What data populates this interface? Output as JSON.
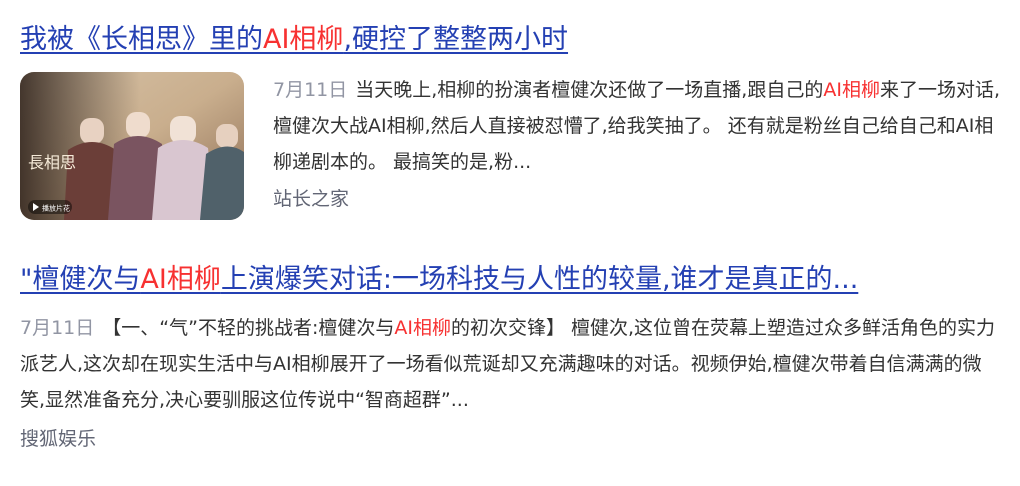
{
  "results": [
    {
      "title_parts": {
        "pre": "我被《长相思》里的",
        "hl": "AI相柳",
        "post": ",硬控了整整两小时"
      },
      "thumbnail": {
        "logo_text": "長相思",
        "button_text": "播放片花"
      },
      "date": "7月11日",
      "abstract_parts": {
        "pre": "当天晚上,相柳的扮演者檀健次还做了一场直播,跟自己的",
        "hl": "AI相柳",
        "post": "来了一场对话,檀健次大战AI相柳,然后人直接被怼懵了,给我笑抽了。 还有就是粉丝自己给自己和AI相柳递剧本的。 最搞笑的是,粉..."
      },
      "source": "站长之家"
    },
    {
      "title_parts": {
        "pre": "\"檀健次与",
        "hl": "AI相柳",
        "post": "上演爆笑对话:一场科技与人性的较量,谁才是真正的..."
      },
      "date": "7月11日",
      "abstract_parts": {
        "pre": "【一、“气”不轻的挑战者:檀健次与",
        "hl": "AI相柳",
        "post": "的初次交锋】 檀健次,这位曾在荧幕上塑造过众多鲜活角色的实力派艺人,这次却在现实生活中与AI相柳展开了一场看似荒诞却又充满趣味的对话。视频伊始,檀健次带着自信满满的微笑,显然准备充分,决心要驯服这位传说中“智商超群”..."
      },
      "source": "搜狐娱乐"
    }
  ],
  "colors": {
    "link": "#2440b3",
    "highlight": "#f73131",
    "text": "#333333",
    "date": "#9195a3",
    "source": "#626675"
  }
}
